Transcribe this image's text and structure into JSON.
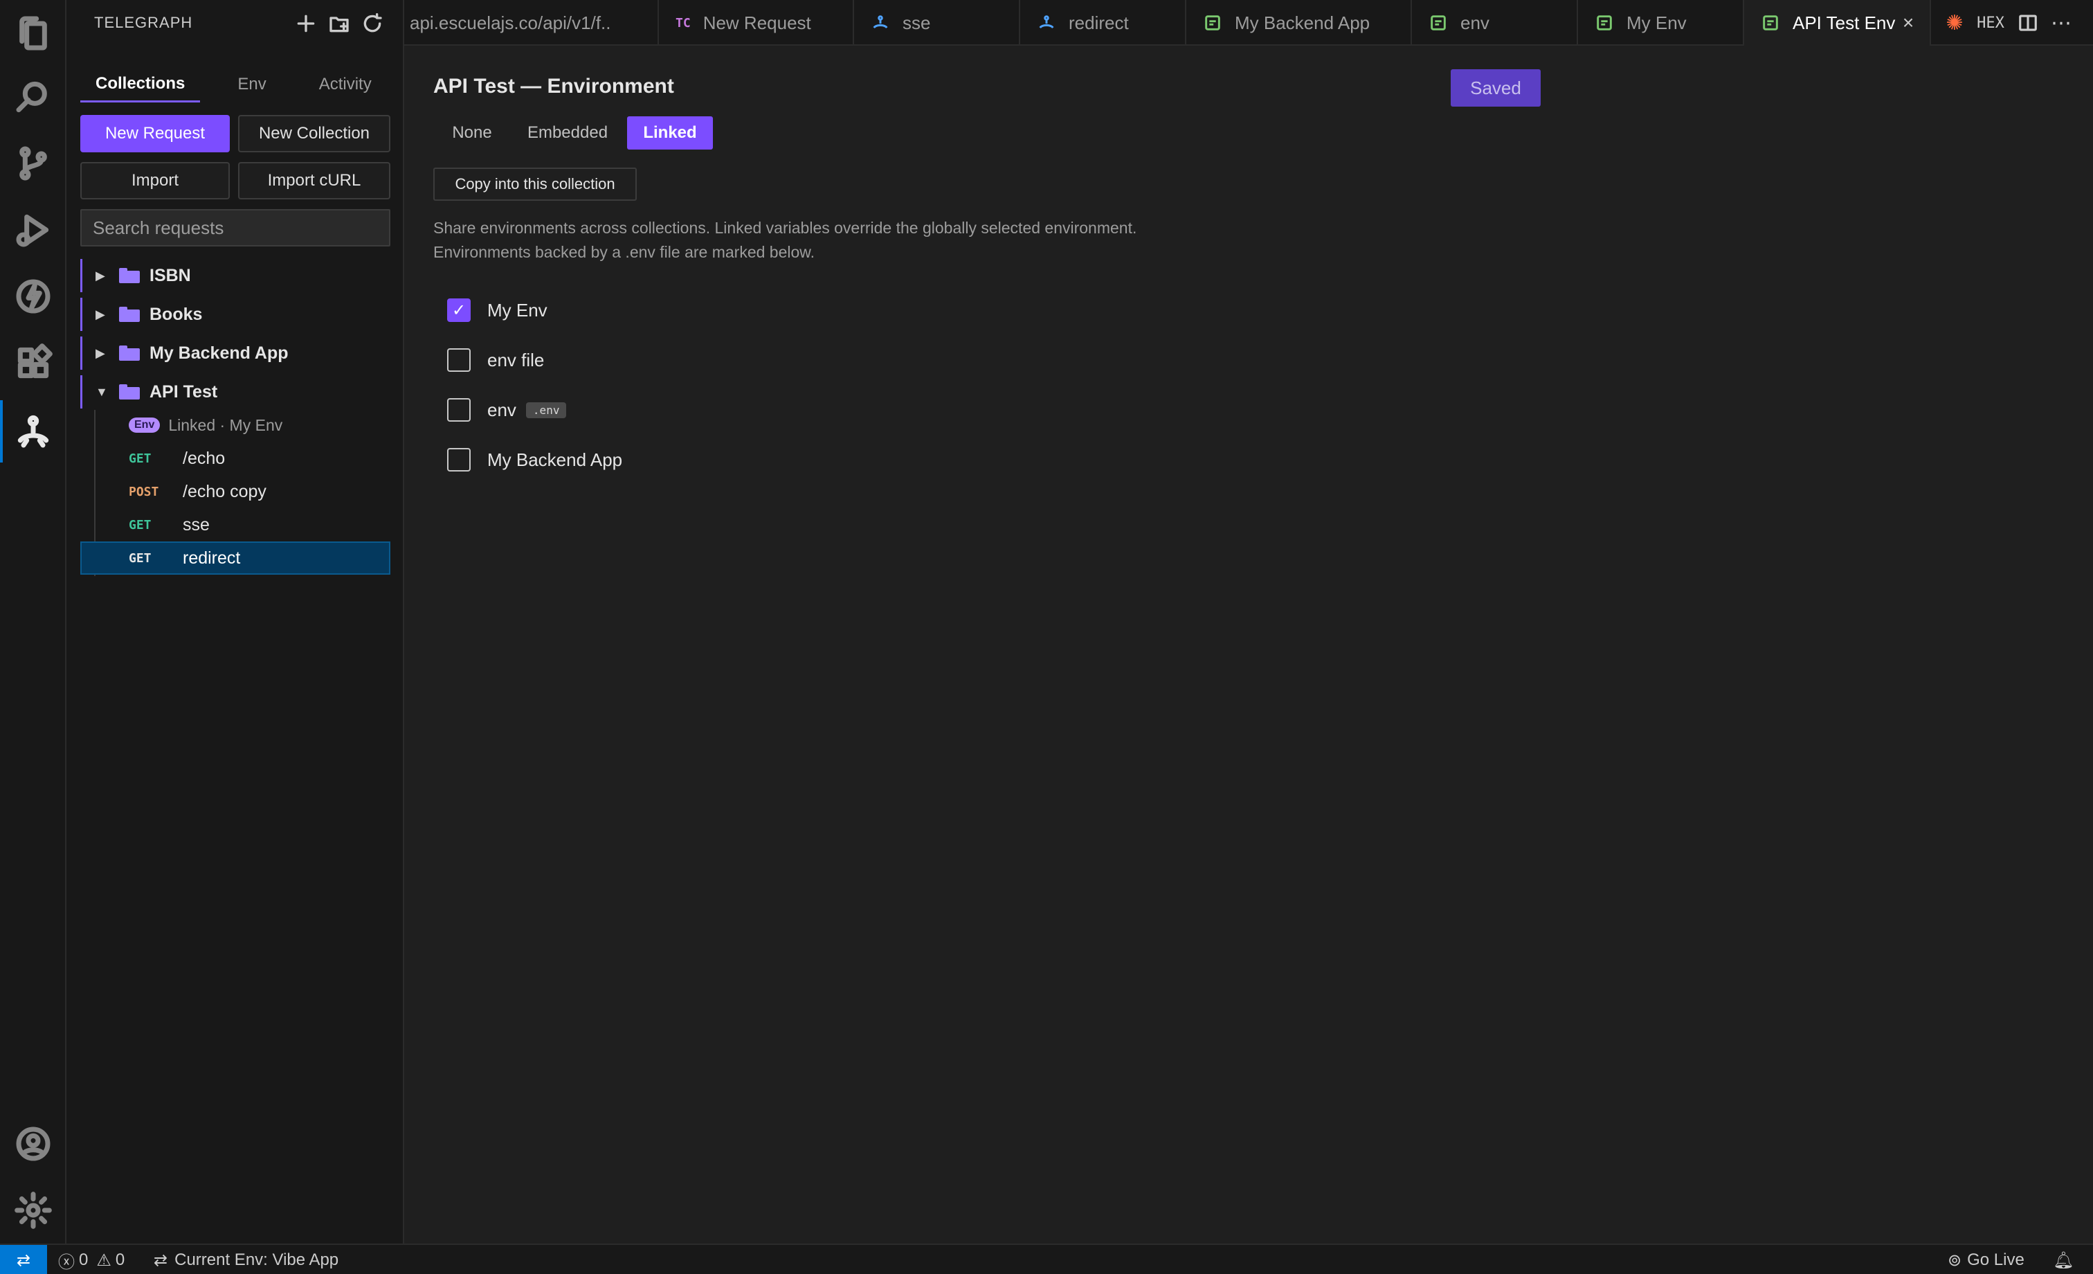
{
  "sidebar": {
    "title": "TELEGRAPH",
    "tabs": [
      {
        "label": "Collections",
        "active": true
      },
      {
        "label": "Env",
        "active": false
      },
      {
        "label": "Activity",
        "active": false
      }
    ],
    "buttons": {
      "new_request": "New Request",
      "new_collection": "New Collection",
      "import": "Import",
      "import_curl": "Import cURL"
    },
    "search_placeholder": "Search requests",
    "folders": [
      {
        "label": "ISBN",
        "expanded": false
      },
      {
        "label": "Books",
        "expanded": false
      },
      {
        "label": "My Backend App",
        "expanded": false
      },
      {
        "label": "API Test",
        "expanded": true
      }
    ],
    "env_item": {
      "badge": "Env",
      "label": "Linked · My Env"
    },
    "requests": [
      {
        "method": "GET",
        "name": "/echo"
      },
      {
        "method": "POST",
        "name": "/echo copy"
      },
      {
        "method": "GET",
        "name": "sse"
      },
      {
        "method": "GET",
        "name": "redirect",
        "selected": true
      }
    ]
  },
  "tabs": [
    {
      "label": "api.escuelajs.co/api/v1/f..",
      "icon": "none"
    },
    {
      "label": "New Request",
      "icon": "tc-icon"
    },
    {
      "label": "sse",
      "icon": "telegraph-icon"
    },
    {
      "label": "redirect",
      "icon": "telegraph-icon"
    },
    {
      "label": "My Backend App",
      "icon": "env-file-icon"
    },
    {
      "label": "env",
      "icon": "env-file-icon"
    },
    {
      "label": "My Env",
      "icon": "env-file-icon"
    },
    {
      "label": "API Test Env",
      "icon": "env-file-icon",
      "active": true
    }
  ],
  "editor_actions": {
    "hex_label": "HEX"
  },
  "main": {
    "title": "API Test — Environment",
    "saved_label": "Saved",
    "modes": [
      {
        "label": "None",
        "active": false
      },
      {
        "label": "Embedded",
        "active": false
      },
      {
        "label": "Linked",
        "active": true
      }
    ],
    "copy_button": "Copy into this collection",
    "description_1": "Share environments across collections. Linked variables override the globally selected environment.",
    "description_2": "Environments backed by a .env file are marked below.",
    "environments": [
      {
        "label": "My Env",
        "checked": true,
        "tag": ""
      },
      {
        "label": "env file",
        "checked": false,
        "tag": ""
      },
      {
        "label": "env",
        "checked": false,
        "tag": ".env"
      },
      {
        "label": "My Backend App",
        "checked": false,
        "tag": ""
      }
    ]
  },
  "statusbar": {
    "errors": "0",
    "warnings": "0",
    "current_env": "Current Env: Vibe App",
    "go_live": "Go Live"
  },
  "colors": {
    "accent": "#7c4dff",
    "selection": "#04395e",
    "statusbar_remote": "#0078d4",
    "get_method": "#3fc59a",
    "post_method": "#e5a16b"
  }
}
